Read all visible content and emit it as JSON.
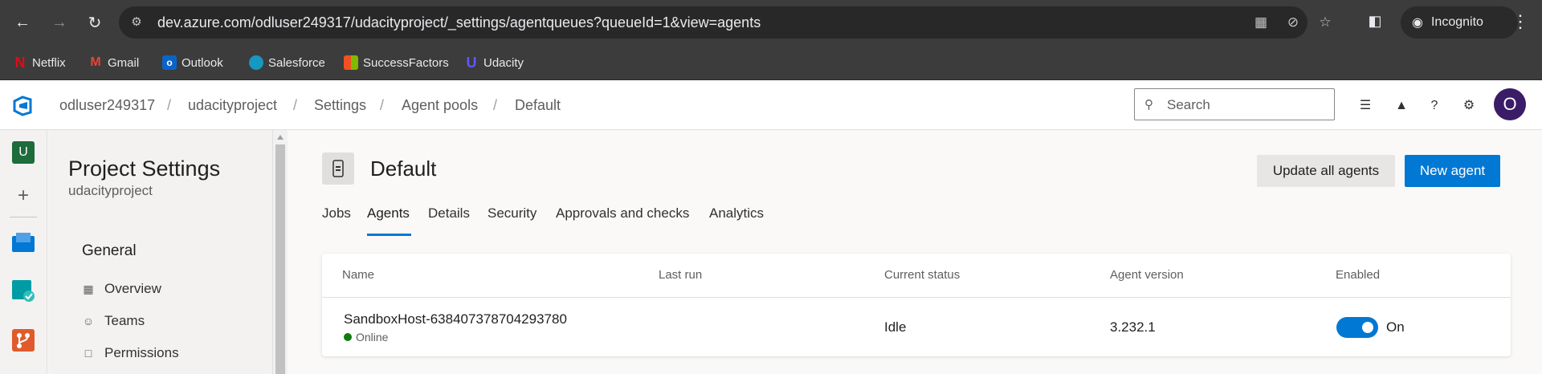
{
  "browser": {
    "url": "dev.azure.com/odluser249317/udacityproject/_settings/agentqueues?queueId=1&view=agents",
    "profile_label": "Incognito",
    "bookmarks": [
      {
        "label": "Netflix",
        "icon": "netflix-icon"
      },
      {
        "label": "Gmail",
        "icon": "gmail-icon"
      },
      {
        "label": "Outlook",
        "icon": "outlook-icon"
      },
      {
        "label": "Salesforce",
        "icon": "salesforce-icon"
      },
      {
        "label": "SuccessFactors",
        "icon": "successfactors-icon"
      },
      {
        "label": "Udacity",
        "icon": "udacity-icon"
      }
    ]
  },
  "header": {
    "breadcrumbs": [
      "odluser249317",
      "udacityproject",
      "Settings",
      "Agent pools",
      "Default"
    ],
    "separator": "/",
    "search_placeholder": "Search",
    "avatar_initial": "O"
  },
  "rail": {
    "project_initial": "U"
  },
  "settings": {
    "title": "Project Settings",
    "subtitle": "udacityproject",
    "section": "General",
    "items": [
      "Overview",
      "Teams",
      "Permissions"
    ]
  },
  "pool": {
    "title": "Default",
    "update_button": "Update all agents",
    "new_button": "New agent",
    "tabs": [
      "Jobs",
      "Agents",
      "Details",
      "Security",
      "Approvals and checks",
      "Analytics"
    ],
    "active_tab": "Agents"
  },
  "agents_table": {
    "columns": [
      "Name",
      "Last run",
      "Current status",
      "Agent version",
      "Enabled"
    ],
    "rows": [
      {
        "name": "SandboxHost-638407378704293780",
        "online_status": "Online",
        "last_run": "",
        "current_status": "Idle",
        "version": "3.232.1",
        "enabled_label": "On"
      }
    ]
  },
  "colors": {
    "accent": "#0078d4",
    "online": "#107c10",
    "avatar": "#3b1c67"
  }
}
